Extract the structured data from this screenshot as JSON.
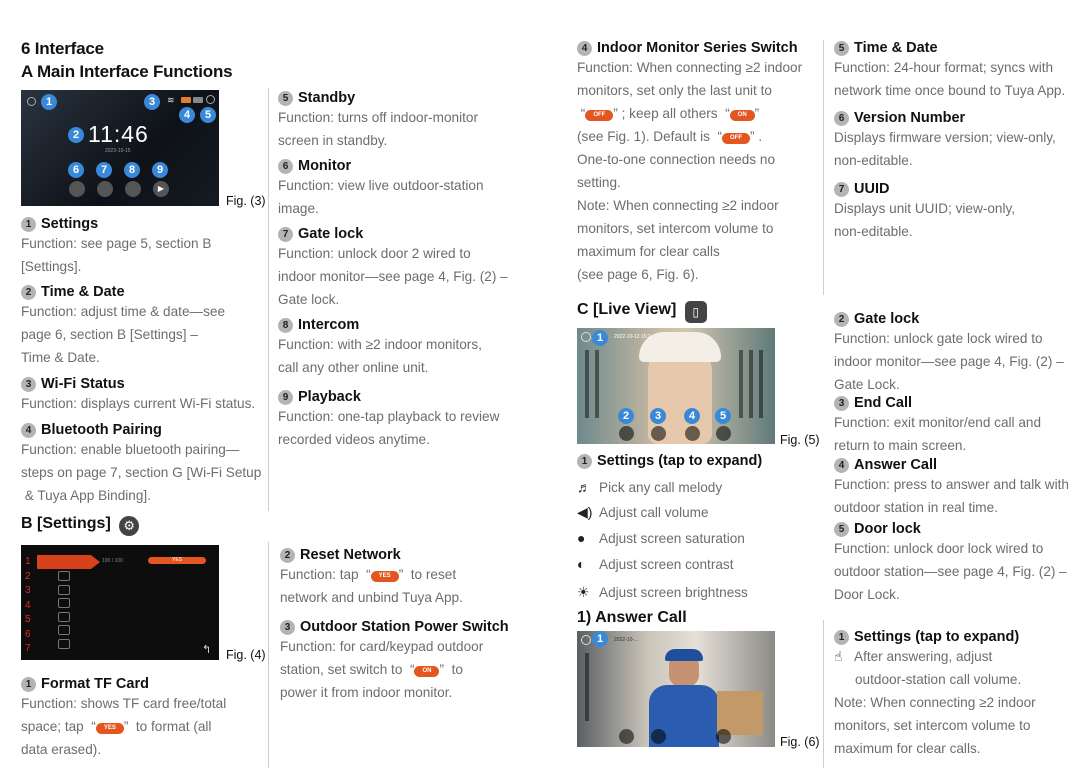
{
  "col1": {
    "title": "6 Interface",
    "subtitle": "A Main Interface Functions",
    "fig3_label": "Fig. (3)",
    "fig3_screen": {
      "time": "11:46",
      "date": "2023-10-15"
    },
    "items": [
      {
        "n": "1",
        "head": "Settings",
        "lines": [
          "Function: see page 5, section B",
          "[Settings]."
        ]
      },
      {
        "n": "2",
        "head": "Time & Date",
        "lines": [
          "Function: adjust time & date—see",
          "page 6, section B [Settings] –",
          "Time & Date."
        ]
      },
      {
        "n": "3",
        "head": "Wi-Fi Status",
        "lines": [
          "Function: displays current Wi-Fi status."
        ]
      },
      {
        "n": "4",
        "head": "Bluetooth Pairing",
        "lines": [
          "Function: enable bluetooth pairing—",
          "steps on page 7, section G [Wi-Fi Setup",
          " & Tuya App Binding]."
        ]
      }
    ],
    "settings_title": "B  [Settings]",
    "fig4_label": "Fig. (4)",
    "fig4_screen": {
      "row_text": "100 / 100",
      "yes": "YES",
      "row_numbers": [
        "1",
        "2",
        "3",
        "4",
        "5",
        "6",
        "7"
      ]
    },
    "format": {
      "n": "1",
      "head": "Format TF Card",
      "l1": "Function: shows TF card free/total",
      "l2a": "space; tap  “",
      "l2b": "”  to format (all",
      "l3": "data erased).",
      "pill": "YES"
    }
  },
  "col2": {
    "items": [
      {
        "n": "5",
        "head": "Standby",
        "lines": [
          "Function: turns off indoor-monitor",
          "screen in standby."
        ]
      },
      {
        "n": "6",
        "head": "Monitor",
        "lines": [
          "Function: view live outdoor-station",
          "image."
        ]
      },
      {
        "n": "7",
        "head": "Gate lock",
        "lines": [
          "Function: unlock door 2 wired to",
          "indoor monitor—see page 4, Fig. (2) –",
          "Gate lock."
        ]
      },
      {
        "n": "8",
        "head": "Intercom",
        "lines": [
          "Function: with ≥2 indoor monitors,",
          "call any other online unit."
        ]
      },
      {
        "n": "9",
        "head": "Playback",
        "lines": [
          "Function: one-tap playback to review",
          "recorded videos anytime."
        ]
      }
    ],
    "reset": {
      "n": "2",
      "head": "Reset Network",
      "l1a": "Function: tap  “",
      "l1b": "”  to reset",
      "l2": "network and unbind Tuya App.",
      "pill": "YES"
    },
    "power": {
      "n": "3",
      "head": "Outdoor Station Power Switch",
      "l1": "Function: for card/keypad outdoor",
      "l2a": "station, set switch to  “",
      "l2b": "”  to",
      "l3": "power it from indoor monitor.",
      "pill": "ON"
    }
  },
  "col3": {
    "switch": {
      "n": "4",
      "head": "Indoor Monitor Series Switch",
      "l1": "Function: When connecting ≥2 indoor",
      "l2": "monitors, set only the last unit to",
      "l3a": "“",
      "l3b": "” ; keep all others  “",
      "l3c": "”",
      "l4a": "(see Fig. 1). Default is  “",
      "l4b": "” .",
      "l5": "One-to-one connection needs no",
      "l6": "setting.",
      "l7": "Note: When connecting ≥2 indoor",
      "l8": "monitors, set intercom volume to",
      "l9": "maximum for clear calls",
      "l10": "(see page 6, Fig. 6).",
      "pill_off": "OFF",
      "pill_on": "ON"
    },
    "live_title": "C  [Live View]",
    "fig5_label": "Fig. (5)",
    "fig5_screen": {
      "date": "2022-10-12 15:2"
    },
    "live_settings_head": "Settings (tap to expand)",
    "live_settings_n": "1",
    "live_options": [
      "Pick any call melody",
      "Adjust call volume",
      "Adjust screen saturation",
      "Adjust screen contrast",
      "Adjust screen brightness"
    ],
    "answer_title": "1) Answer Call",
    "fig6_label": "Fig. (6)",
    "fig6_screen": {
      "date": "2022-10-..."
    }
  },
  "col4": {
    "time": {
      "n": "5",
      "head": "Time & Date",
      "lines": [
        "Function: 24-hour format; syncs with",
        "network time once bound to Tuya App."
      ]
    },
    "version": {
      "n": "6",
      "head": "Version Number",
      "lines": [
        "Displays firmware version; view-only,",
        "non-editable."
      ]
    },
    "uuid": {
      "n": "7",
      "head": "UUID",
      "lines": [
        "Displays unit UUID; view-only,",
        "non-editable."
      ]
    },
    "gate": {
      "n": "2",
      "head": "Gate lock",
      "lines": [
        "Function: unlock gate lock wired to",
        "indoor monitor—see page 4, Fig. (2) –",
        "Gate Lock."
      ]
    },
    "endcall": {
      "n": "3",
      "head": "End Call",
      "lines": [
        "Function: exit monitor/end call and",
        "return to main screen."
      ]
    },
    "answer": {
      "n": "4",
      "head": "Answer Call",
      "lines": [
        "Function: press to answer and talk with",
        "outdoor station in real time."
      ]
    },
    "door": {
      "n": "5",
      "head": "Door lock",
      "lines": [
        "Function: unlock door lock wired to",
        "outdoor station—see page 4, Fig. (2) –",
        "Door Lock."
      ]
    },
    "settings": {
      "n": "1",
      "head": "Settings (tap to expand)",
      "l1": "After answering, adjust",
      "l2": "outdoor-station call volume.",
      "l3": "Note: When connecting ≥2 indoor",
      "l4": "monitors, set intercom volume to",
      "l5": "maximum for clear calls."
    }
  }
}
